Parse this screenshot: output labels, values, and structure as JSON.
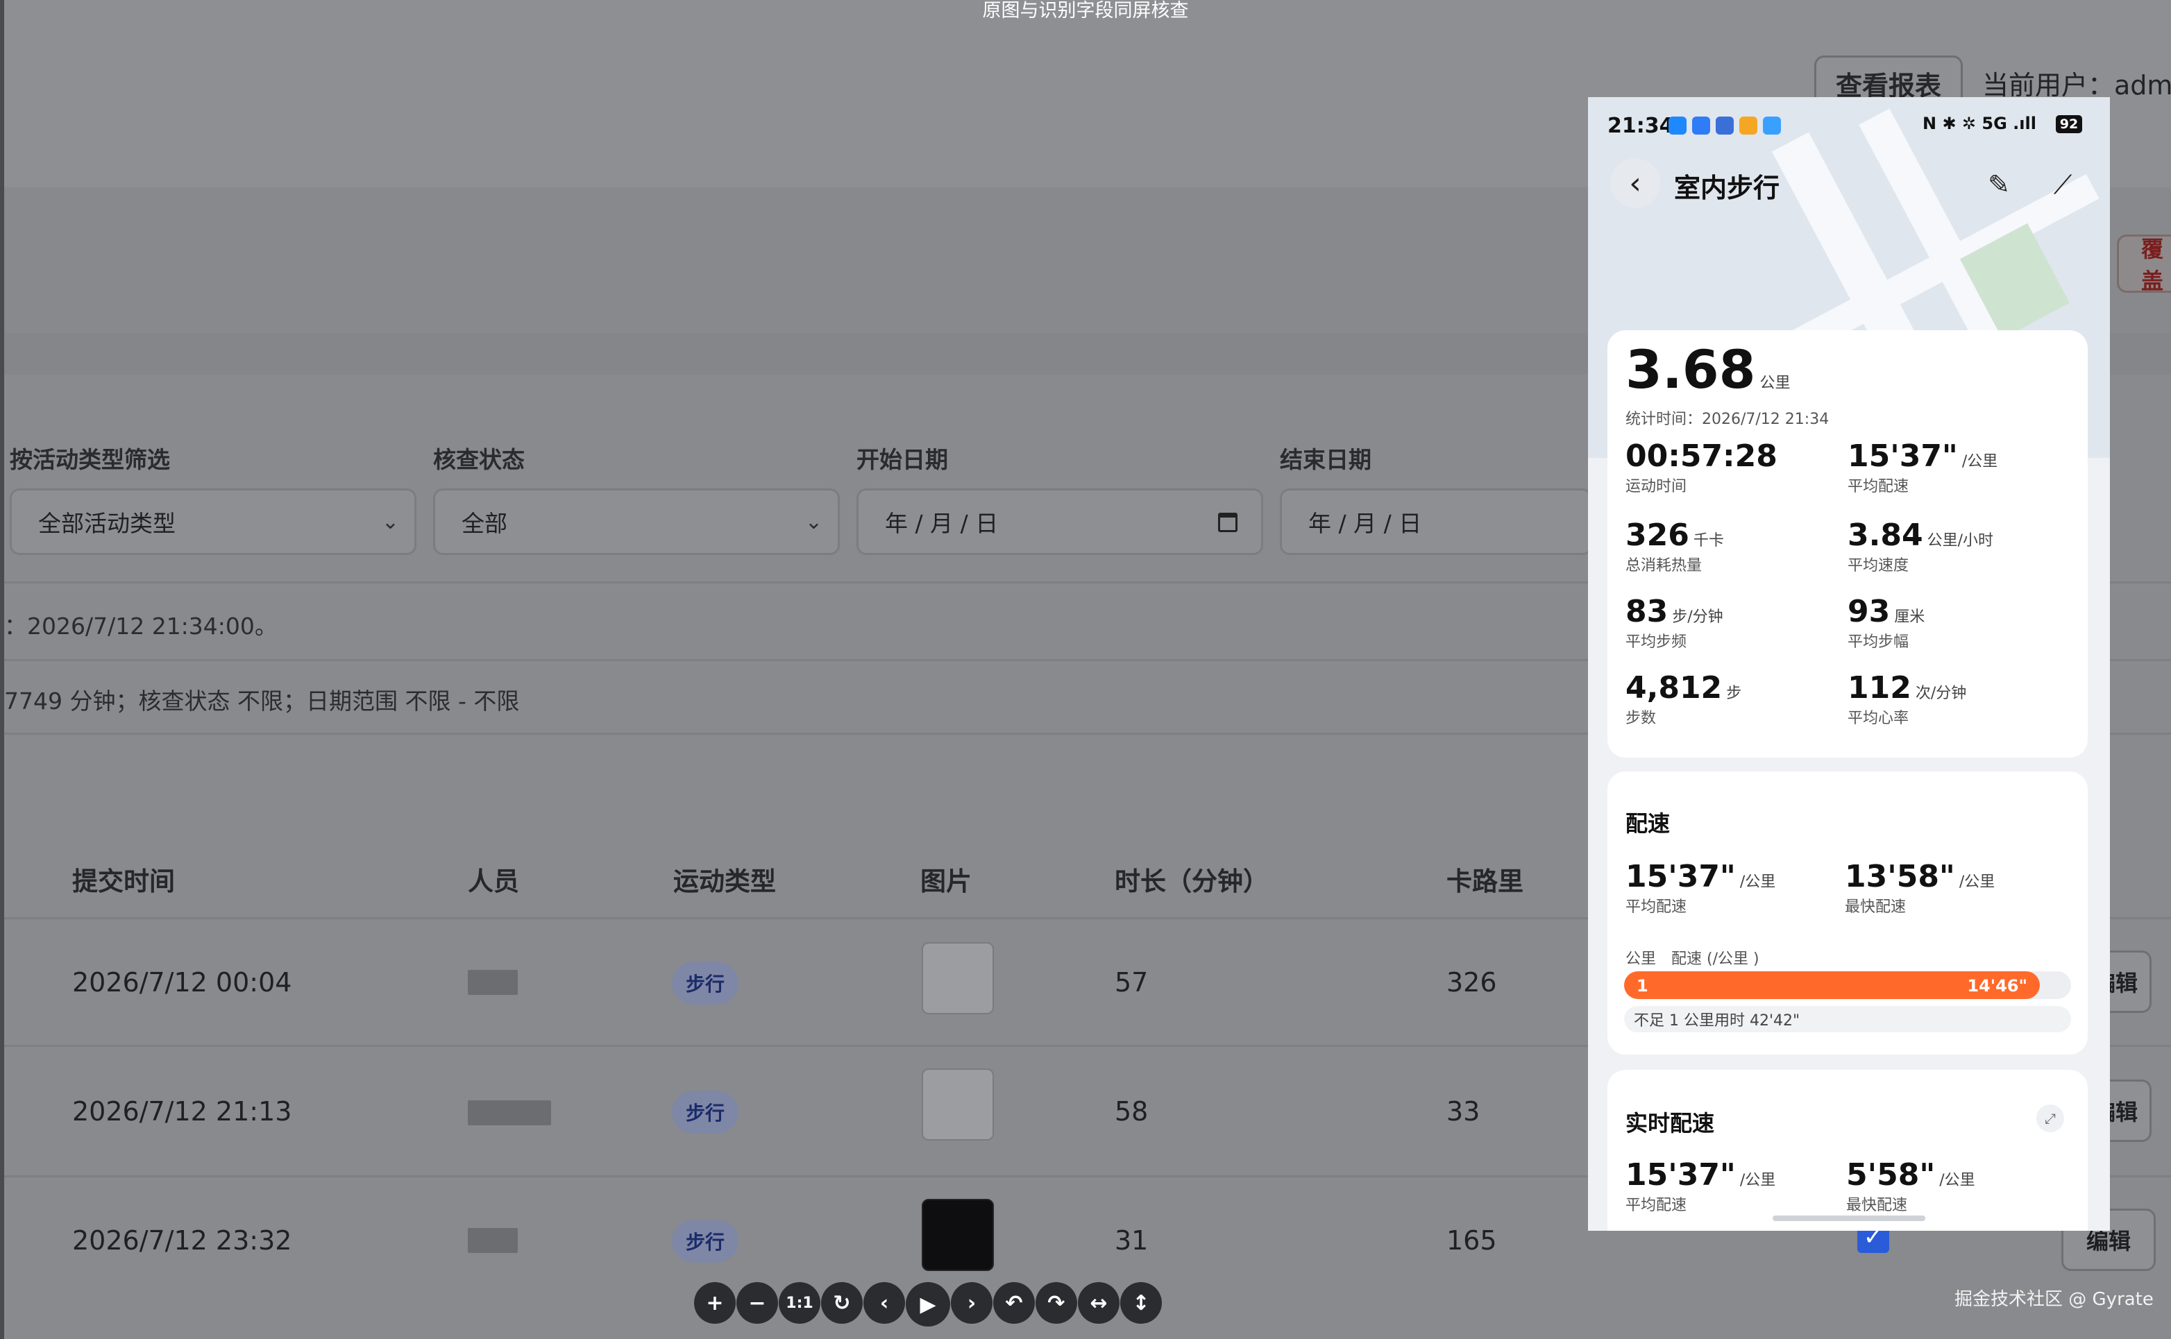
{
  "screen_caption": "原图与识别字段同屏核查",
  "admin": {
    "report_button": "查看报表",
    "current_user": "当前用户：admi",
    "cover_button": "覆盖",
    "filters": [
      {
        "label": "按活动类型筛选",
        "value": "全部活动类型",
        "kind": "select"
      },
      {
        "label": "核查状态",
        "value": "全部",
        "kind": "select"
      },
      {
        "label": "开始日期",
        "value": "年 / 月 / 日",
        "kind": "date"
      },
      {
        "label": "结束日期",
        "value": "年 / 月 / 日",
        "kind": "date"
      }
    ],
    "info_line_1": "：2026/7/12 21:34:00。",
    "info_line_2": "7749 分钟；核查状态 不限；日期范围 不限 - 不限",
    "table": {
      "headers": [
        "提交时间",
        "人员",
        "运动类型",
        "图片",
        "时长（分钟）",
        "卡路里"
      ],
      "rows": [
        {
          "time": "2026/7/12 00:04",
          "type": "步行",
          "duration": "57",
          "calories": "326",
          "edit": "编辑"
        },
        {
          "time": "2026/7/12 21:13",
          "type": "步行",
          "duration": "58",
          "calories": "33",
          "edit": "编辑"
        },
        {
          "time": "2026/7/12 23:32",
          "type": "步行",
          "duration": "31",
          "calories": "165",
          "edit": "编辑"
        }
      ]
    }
  },
  "toolbar": [
    "+",
    "−",
    "1:1",
    "↻",
    "‹",
    "▶",
    "›",
    "↶",
    "↷",
    "↔",
    "↕"
  ],
  "watermark": "掘金技术社区 @ Gyrate",
  "phone": {
    "status_time": "21:34",
    "status_right": "N ✱ ✲ 5G .ıll",
    "battery": "92",
    "title": "室内步行",
    "summary": {
      "distance": "3.68",
      "distance_unit": "公里",
      "stat_time": "统计时间：2026/7/12 21:34",
      "metrics": [
        {
          "value": "00:57:28",
          "unit": "",
          "label": "运动时间"
        },
        {
          "value": "15'37\"",
          "unit": "/公里",
          "label": "平均配速"
        },
        {
          "value": "326",
          "unit": "千卡",
          "label": "总消耗热量"
        },
        {
          "value": "3.84",
          "unit": "公里/小时",
          "label": "平均速度"
        },
        {
          "value": "83",
          "unit": "步/分钟",
          "label": "平均步频"
        },
        {
          "value": "93",
          "unit": "厘米",
          "label": "平均步幅"
        },
        {
          "value": "4,812",
          "unit": "步",
          "label": "步数"
        },
        {
          "value": "112",
          "unit": "次/分钟",
          "label": "平均心率"
        }
      ]
    },
    "pace": {
      "title": "配速",
      "avg_value": "15'37\"",
      "avg_unit": "/公里",
      "avg_label": "平均配速",
      "fast_value": "13'58\"",
      "fast_unit": "/公里",
      "fast_label": "最快配速",
      "col_km": "公里",
      "col_pace": "配速 (/公里 )",
      "bar_km": "1",
      "bar_pace": "14'46\"",
      "bar_fill_fraction": 0.93,
      "short_note": "不足 1 公里用时 42'42\""
    },
    "realtime": {
      "title": "实时配速",
      "avg_value": "15'37\"",
      "avg_unit": "/公里",
      "avg_label": "平均配速",
      "fast_value": "5'58\"",
      "fast_unit": "/公里",
      "fast_label": "最快配速"
    }
  }
}
